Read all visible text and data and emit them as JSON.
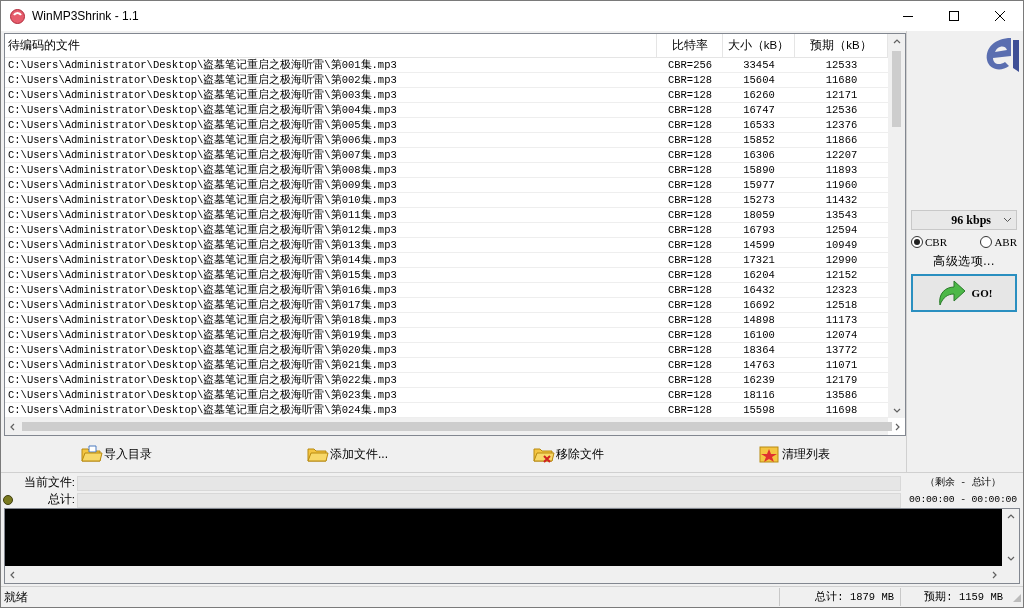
{
  "window": {
    "title": "WinMP3Shrink - 1.1"
  },
  "file_list": {
    "columns": [
      "待编码的文件",
      "比特率",
      "大小（kB）",
      "预期（kB）"
    ],
    "rows": [
      {
        "file": "C:\\Users\\Administrator\\Desktop\\盗墓笔记重启之极海听雷\\第001集.mp3",
        "bitrate": "CBR=256",
        "size": "33454",
        "expected": "12533"
      },
      {
        "file": "C:\\Users\\Administrator\\Desktop\\盗墓笔记重启之极海听雷\\第002集.mp3",
        "bitrate": "CBR=128",
        "size": "15604",
        "expected": "11680"
      },
      {
        "file": "C:\\Users\\Administrator\\Desktop\\盗墓笔记重启之极海听雷\\第003集.mp3",
        "bitrate": "CBR=128",
        "size": "16260",
        "expected": "12171"
      },
      {
        "file": "C:\\Users\\Administrator\\Desktop\\盗墓笔记重启之极海听雷\\第004集.mp3",
        "bitrate": "CBR=128",
        "size": "16747",
        "expected": "12536"
      },
      {
        "file": "C:\\Users\\Administrator\\Desktop\\盗墓笔记重启之极海听雷\\第005集.mp3",
        "bitrate": "CBR=128",
        "size": "16533",
        "expected": "12376"
      },
      {
        "file": "C:\\Users\\Administrator\\Desktop\\盗墓笔记重启之极海听雷\\第006集.mp3",
        "bitrate": "CBR=128",
        "size": "15852",
        "expected": "11866"
      },
      {
        "file": "C:\\Users\\Administrator\\Desktop\\盗墓笔记重启之极海听雷\\第007集.mp3",
        "bitrate": "CBR=128",
        "size": "16306",
        "expected": "12207"
      },
      {
        "file": "C:\\Users\\Administrator\\Desktop\\盗墓笔记重启之极海听雷\\第008集.mp3",
        "bitrate": "CBR=128",
        "size": "15890",
        "expected": "11893"
      },
      {
        "file": "C:\\Users\\Administrator\\Desktop\\盗墓笔记重启之极海听雷\\第009集.mp3",
        "bitrate": "CBR=128",
        "size": "15977",
        "expected": "11960"
      },
      {
        "file": "C:\\Users\\Administrator\\Desktop\\盗墓笔记重启之极海听雷\\第010集.mp3",
        "bitrate": "CBR=128",
        "size": "15273",
        "expected": "11432"
      },
      {
        "file": "C:\\Users\\Administrator\\Desktop\\盗墓笔记重启之极海听雷\\第011集.mp3",
        "bitrate": "CBR=128",
        "size": "18059",
        "expected": "13543"
      },
      {
        "file": "C:\\Users\\Administrator\\Desktop\\盗墓笔记重启之极海听雷\\第012集.mp3",
        "bitrate": "CBR=128",
        "size": "16793",
        "expected": "12594"
      },
      {
        "file": "C:\\Users\\Administrator\\Desktop\\盗墓笔记重启之极海听雷\\第013集.mp3",
        "bitrate": "CBR=128",
        "size": "14599",
        "expected": "10949"
      },
      {
        "file": "C:\\Users\\Administrator\\Desktop\\盗墓笔记重启之极海听雷\\第014集.mp3",
        "bitrate": "CBR=128",
        "size": "17321",
        "expected": "12990"
      },
      {
        "file": "C:\\Users\\Administrator\\Desktop\\盗墓笔记重启之极海听雷\\第015集.mp3",
        "bitrate": "CBR=128",
        "size": "16204",
        "expected": "12152"
      },
      {
        "file": "C:\\Users\\Administrator\\Desktop\\盗墓笔记重启之极海听雷\\第016集.mp3",
        "bitrate": "CBR=128",
        "size": "16432",
        "expected": "12323"
      },
      {
        "file": "C:\\Users\\Administrator\\Desktop\\盗墓笔记重启之极海听雷\\第017集.mp3",
        "bitrate": "CBR=128",
        "size": "16692",
        "expected": "12518"
      },
      {
        "file": "C:\\Users\\Administrator\\Desktop\\盗墓笔记重启之极海听雷\\第018集.mp3",
        "bitrate": "CBR=128",
        "size": "14898",
        "expected": "11173"
      },
      {
        "file": "C:\\Users\\Administrator\\Desktop\\盗墓笔记重启之极海听雷\\第019集.mp3",
        "bitrate": "CBR=128",
        "size": "16100",
        "expected": "12074"
      },
      {
        "file": "C:\\Users\\Administrator\\Desktop\\盗墓笔记重启之极海听雷\\第020集.mp3",
        "bitrate": "CBR=128",
        "size": "18364",
        "expected": "13772"
      },
      {
        "file": "C:\\Users\\Administrator\\Desktop\\盗墓笔记重启之极海听雷\\第021集.mp3",
        "bitrate": "CBR=128",
        "size": "14763",
        "expected": "11071"
      },
      {
        "file": "C:\\Users\\Administrator\\Desktop\\盗墓笔记重启之极海听雷\\第022集.mp3",
        "bitrate": "CBR=128",
        "size": "16239",
        "expected": "12179"
      },
      {
        "file": "C:\\Users\\Administrator\\Desktop\\盗墓笔记重启之极海听雷\\第023集.mp3",
        "bitrate": "CBR=128",
        "size": "18116",
        "expected": "13586"
      },
      {
        "file": "C:\\Users\\Administrator\\Desktop\\盗墓笔记重启之极海听雷\\第024集.mp3",
        "bitrate": "CBR=128",
        "size": "15598",
        "expected": "11698"
      }
    ]
  },
  "side_panel": {
    "bitrate": "96 kbps",
    "modes": [
      {
        "label": "CBR",
        "selected": true
      },
      {
        "label": "ABR",
        "selected": false
      }
    ],
    "advanced": "高级选项...",
    "go": "GO!"
  },
  "toolbar": [
    {
      "label": "导入目录",
      "kind": "import"
    },
    {
      "label": "添加文件...",
      "kind": "add"
    },
    {
      "label": "移除文件",
      "kind": "remove"
    },
    {
      "label": "清理列表",
      "kind": "clear"
    }
  ],
  "progress": {
    "rows": [
      {
        "label": "当前文件:",
        "level": 0
      },
      {
        "label": "总计:",
        "level": 0
      }
    ],
    "time_header": "（剩余 - 总计）",
    "time": "00:00:00 - 00:00:00"
  },
  "status_bar": {
    "status": "就绪",
    "total": "总计: 1879 MB",
    "expected": "预期: 1159 MB"
  }
}
